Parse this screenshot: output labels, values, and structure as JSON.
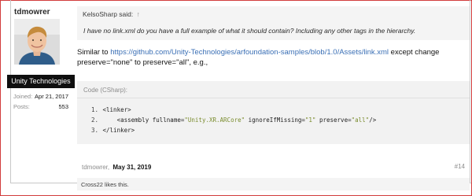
{
  "user": {
    "name": "tdmowrer",
    "title": "Unity Technologies",
    "joined_label": "Joined:",
    "joined_value": "Apr 21, 2017",
    "posts_label": "Posts:",
    "posts_value": "553"
  },
  "quote": {
    "author": "KelsoSharp said:",
    "arrow": "↑",
    "text": "I have no link.xml do you have a full example of what it should contain? Including any other tags in the hierarchy."
  },
  "message": {
    "prefix": "Similar to ",
    "link": "https://github.com/Unity-Technologies/arfoundation-samples/blob/1.0/Assets/link.xml",
    "suffix": " except change preserve=\"none\" to preserve=\"all\", e.g.,"
  },
  "code": {
    "title": "Code (CSharp):",
    "lines": [
      {
        "num": "1.",
        "text": "<linker>"
      },
      {
        "num": "2.",
        "pre": "    <assembly fullname=",
        "s1": "\"Unity.XR.ARCore\"",
        "mid": " ignoreIfMissing=",
        "s2": "\"1\"",
        "mid2": " preserve=",
        "s3": "\"all\"",
        "post": "/>"
      },
      {
        "num": "3.",
        "text": "</linker>"
      }
    ]
  },
  "footer": {
    "author": "tdmowrer,",
    "date": "May 31, 2019",
    "post_number": "#14",
    "likes": "Cross22 likes this."
  }
}
